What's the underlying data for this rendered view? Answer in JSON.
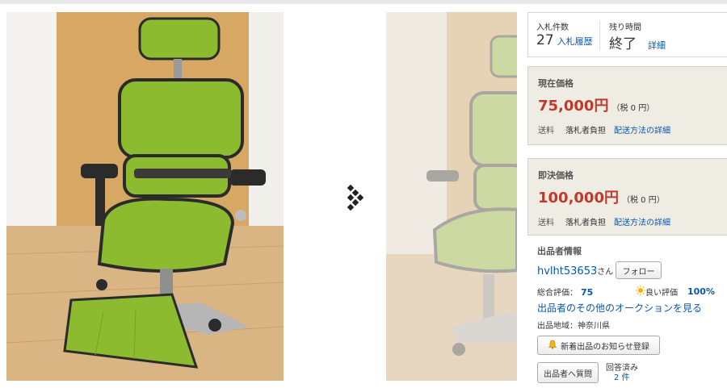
{
  "bids": {
    "label": "入札件数",
    "count": "27",
    "history_link": "入札履歴"
  },
  "time_left": {
    "label": "残り時間",
    "value": "終了",
    "detail_link": "詳細"
  },
  "current_price": {
    "title": "現在価格",
    "amount": "75,000円",
    "tax": "（税 0 円）",
    "shipping_label": "送料",
    "shipping_payer": "落札者負担",
    "shipping_link": "配送方法の詳細"
  },
  "buyout_price": {
    "title": "即決価格",
    "amount": "100,000円",
    "tax": "（税 0 円）",
    "shipping_label": "送料",
    "shipping_payer": "落札者負担",
    "shipping_link": "配送方法の詳細"
  },
  "seller": {
    "title": "出品者情報",
    "name": "hvlht53653",
    "suffix": "さん",
    "follow_label": "フォロー",
    "rating_label": "総合評価：",
    "rating_value": "75",
    "good_label": "良い評価",
    "good_percent": "100%",
    "other_auctions": "出品者のその他のオークションを見る",
    "region": "出品地域：神奈川県",
    "notify_label": "新着出品のお知らせ登録",
    "question_label": "出品者へ質問",
    "answered_label": "回答済み",
    "answered_count": "2 件"
  },
  "icons": {
    "next": "next-image-icon",
    "bell": "bell-icon",
    "sun": "sun-icon"
  },
  "colors": {
    "link": "#0b57a9",
    "price": "#c0392b",
    "price_box": "#efece4",
    "chair_green": "#8dbb2f"
  }
}
